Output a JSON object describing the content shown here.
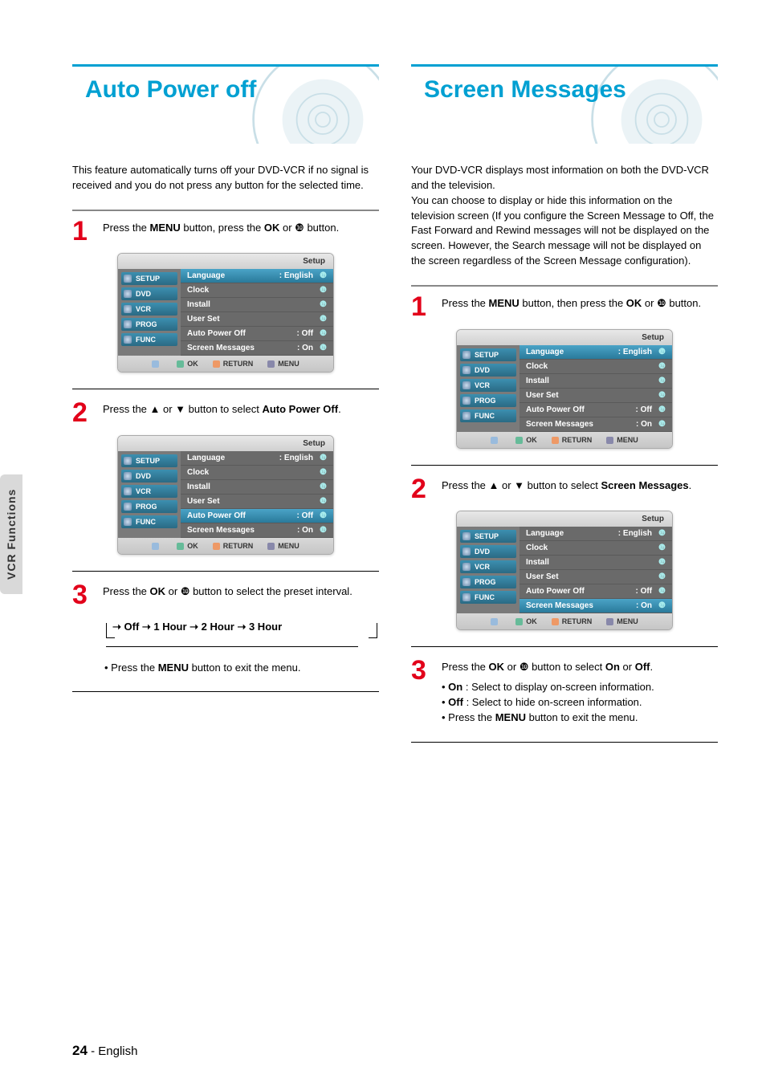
{
  "sideTab": "VCR Functions",
  "pageNumber": "24",
  "pageLang": "English",
  "leftSection": {
    "title": "Auto Power off",
    "intro": "This feature automatically turns off your DVD-VCR if no signal is received and you do not press any button for the selected time.",
    "step1": {
      "num": "1",
      "pre": "Press the ",
      "b1": "MENU",
      "mid": " button, press the ",
      "b2": "OK",
      "post": " or ❿ button."
    },
    "step2": {
      "num": "2",
      "pre": "Press the ",
      "arrows": "▲ or ▼",
      "post1": " button to select ",
      "b1": "Auto Power Off",
      "post2": "."
    },
    "step3": {
      "num": "3",
      "pre": "Press the ",
      "b1": "OK",
      "post": " or ❿ button to select the preset interval."
    },
    "cycle": "➝ Off ➝ 1 Hour ➝ 2 Hour ➝ 3 Hour",
    "bullet1": {
      "dot": "• ",
      "pre": "Press the ",
      "b1": "MENU",
      "post": " button to exit the menu."
    }
  },
  "rightSection": {
    "title": "Screen Messages",
    "intro": "Your DVD-VCR displays most information on both the DVD-VCR and the television.\nYou can choose to display or hide this information on the television screen (If you configure the Screen Message to Off, the Fast Forward and Rewind messages will not be displayed on the screen. However, the Search message will not be displayed on the screen regardless of the Screen Message configuration).",
    "step1": {
      "num": "1",
      "pre": "Press the ",
      "b1": "MENU",
      "mid": " button, then press the ",
      "b2": "OK",
      "post": " or ❿ button."
    },
    "step2": {
      "num": "2",
      "pre": "Press the ",
      "arrows": "▲ or ▼",
      "post1": " button to select ",
      "b1": "Screen Messages",
      "post2": "."
    },
    "step3": {
      "num": "3",
      "pre": "Press the ",
      "b1": "OK",
      "mid": " or ❿ button to select ",
      "b2": "On",
      "mid2": " or ",
      "b3": "Off",
      "post": "."
    },
    "bullet1": {
      "dot": "• ",
      "b1": "On",
      "post": " : Select to display on-screen information."
    },
    "bullet2": {
      "dot": "• ",
      "b1": "Off",
      "post": " : Select to hide on-screen information."
    },
    "bullet3": {
      "dot": "• ",
      "pre": "Press the ",
      "b1": "MENU",
      "post": " button to exit the menu."
    }
  },
  "osd": {
    "header": "Setup",
    "side": [
      "SETUP",
      "DVD",
      "VCR",
      "PROG",
      "FUNC"
    ],
    "menu": [
      {
        "label": "Language",
        "val": ": English"
      },
      {
        "label": "Clock",
        "val": ""
      },
      {
        "label": "Install",
        "val": ""
      },
      {
        "label": "User Set",
        "val": ""
      },
      {
        "label": "Auto Power Off",
        "val": ": Off"
      },
      {
        "label": "Screen Messages",
        "val": ": On"
      }
    ],
    "footer": {
      "move": "",
      "ok": "OK",
      "ret": "RETURN",
      "menu": "MENU"
    }
  }
}
